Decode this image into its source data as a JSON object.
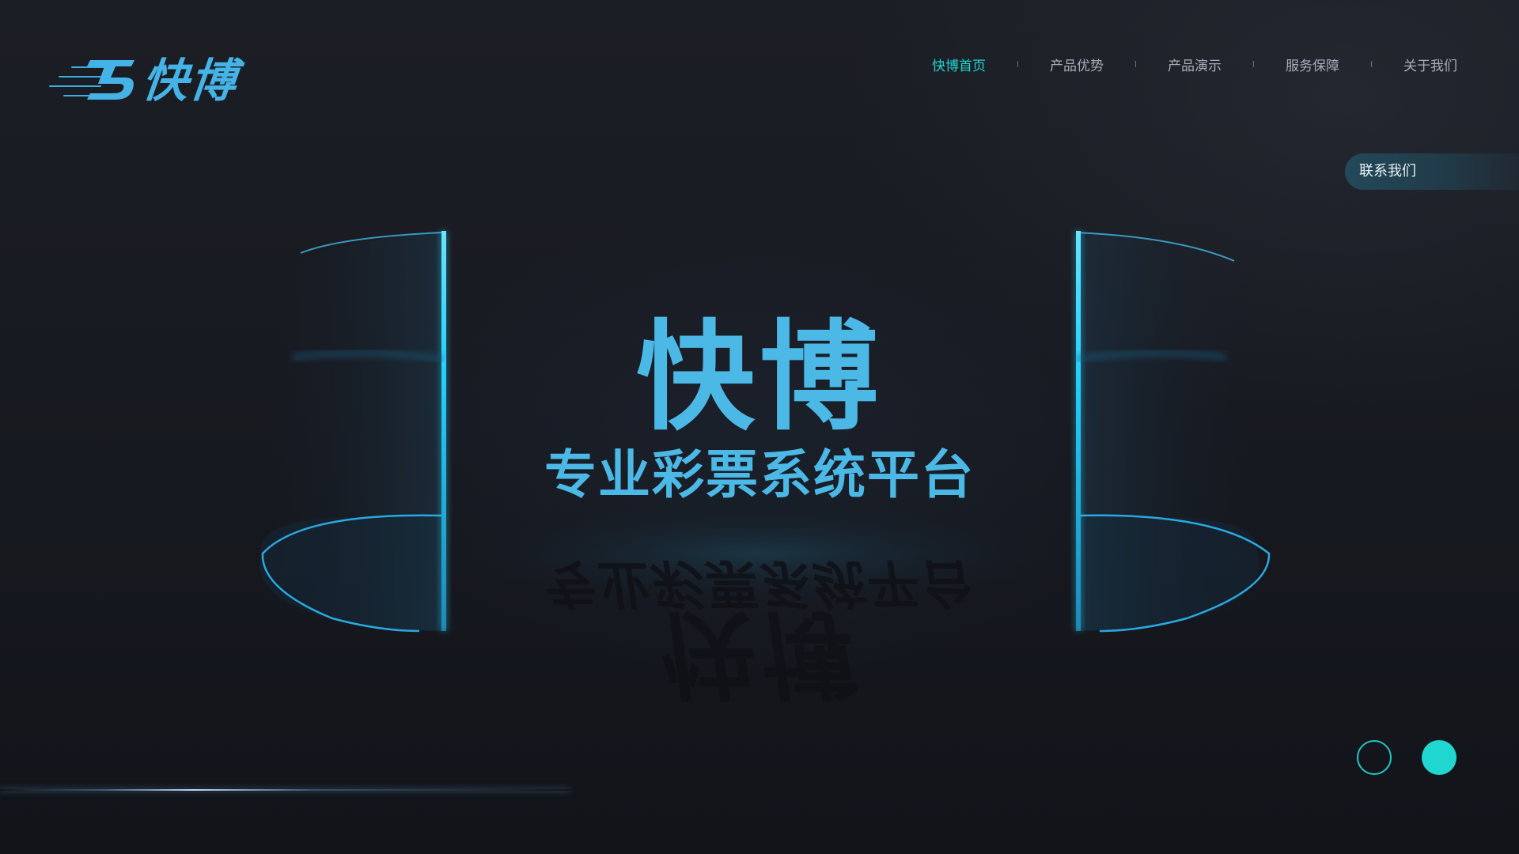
{
  "brand": {
    "name": "快博",
    "accent_color": "#46b3e6",
    "logo_icon": "speed-lines-logo-icon"
  },
  "nav": {
    "items": [
      {
        "label": "快博首页",
        "active": true
      },
      {
        "label": "产品优势",
        "active": false
      },
      {
        "label": "产品演示",
        "active": false
      },
      {
        "label": "服务保障",
        "active": false
      },
      {
        "label": "关于我们",
        "active": false
      }
    ],
    "active_color": "#1fd6d0",
    "inactive_color": "#a8acb6"
  },
  "contact": {
    "label": "联系我们"
  },
  "hero": {
    "title": "快博",
    "subtitle": "专业彩票系统平台",
    "text_color": "#4cb8e6"
  },
  "pager": {
    "slides": 2,
    "current": 2,
    "color": "#1fd6d0"
  }
}
